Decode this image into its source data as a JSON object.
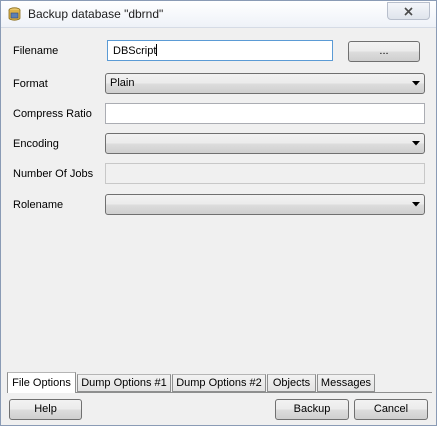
{
  "window": {
    "title": "Backup database \"dbrnd\""
  },
  "form": {
    "filename_label": "Filename",
    "filename_value": "DBScript",
    "browse_label": "...",
    "format_label": "Format",
    "format_value": "Plain",
    "compress_label": "Compress Ratio",
    "compress_value": "",
    "encoding_label": "Encoding",
    "encoding_value": "",
    "jobs_label": "Number Of Jobs",
    "jobs_value": "",
    "rolename_label": "Rolename",
    "rolename_value": ""
  },
  "tabs": [
    {
      "label": "File Options",
      "active": true
    },
    {
      "label": "Dump Options #1",
      "active": false
    },
    {
      "label": "Dump Options #2",
      "active": false
    },
    {
      "label": "Objects",
      "active": false
    },
    {
      "label": "Messages",
      "active": false
    }
  ],
  "buttons": {
    "help": "Help",
    "backup": "Backup",
    "cancel": "Cancel"
  },
  "icons": {
    "app": "database-backup-icon",
    "close": "close-icon",
    "dropdown": "chevron-down-icon"
  }
}
